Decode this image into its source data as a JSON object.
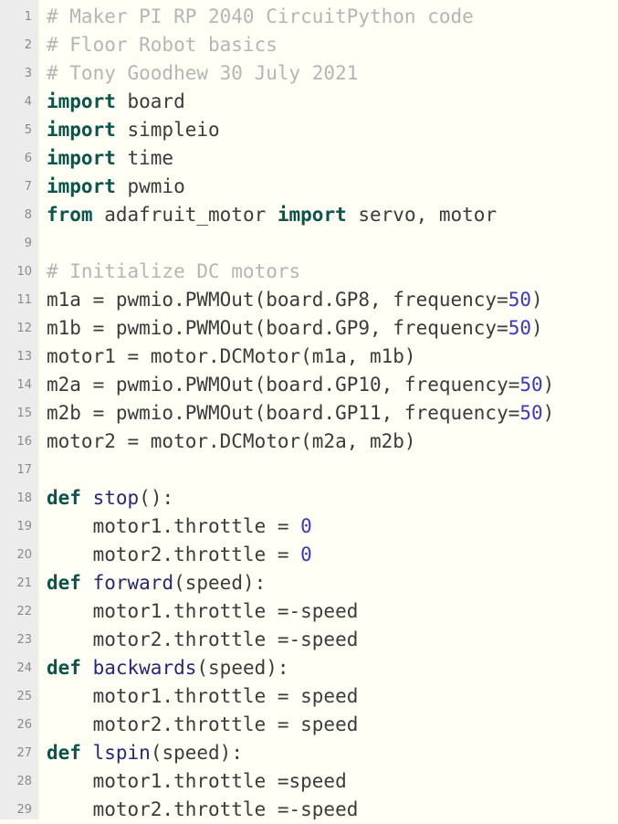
{
  "editor": {
    "language": "python",
    "total_lines": 29,
    "colors": {
      "gutter_background": "#ececec",
      "gutter_text": "#8a8a8a",
      "code_background": "#fffff5",
      "plain_text": "#3b3b3b",
      "comment": "#b5b5b5",
      "keyword": "#0a5449",
      "function_name": "#27277a",
      "number": "#3838c4"
    }
  },
  "lines": [
    {
      "number": "1",
      "tokens": [
        {
          "t": "# Maker PI RP 2040 CircuitPython code",
          "c": "comment"
        }
      ]
    },
    {
      "number": "2",
      "tokens": [
        {
          "t": "# Floor Robot basics",
          "c": "comment"
        }
      ]
    },
    {
      "number": "3",
      "tokens": [
        {
          "t": "# Tony Goodhew 30 July 2021",
          "c": "comment"
        }
      ]
    },
    {
      "number": "4",
      "tokens": [
        {
          "t": "import",
          "c": "keyword"
        },
        {
          "t": " board",
          "c": "plain"
        }
      ]
    },
    {
      "number": "5",
      "tokens": [
        {
          "t": "import",
          "c": "keyword"
        },
        {
          "t": " simpleio",
          "c": "plain"
        }
      ]
    },
    {
      "number": "6",
      "tokens": [
        {
          "t": "import",
          "c": "keyword"
        },
        {
          "t": " time",
          "c": "plain"
        }
      ]
    },
    {
      "number": "7",
      "tokens": [
        {
          "t": "import",
          "c": "keyword"
        },
        {
          "t": " pwmio",
          "c": "plain"
        }
      ]
    },
    {
      "number": "8",
      "tokens": [
        {
          "t": "from",
          "c": "keyword"
        },
        {
          "t": " adafruit_motor ",
          "c": "plain"
        },
        {
          "t": "import",
          "c": "keyword"
        },
        {
          "t": " servo, motor",
          "c": "plain"
        }
      ]
    },
    {
      "number": "9",
      "tokens": []
    },
    {
      "number": "10",
      "tokens": [
        {
          "t": "# Initialize DC motors",
          "c": "comment"
        }
      ]
    },
    {
      "number": "11",
      "tokens": [
        {
          "t": "m1a = pwmio.PWMOut(board.GP8, frequency=",
          "c": "plain"
        },
        {
          "t": "50",
          "c": "number"
        },
        {
          "t": ")",
          "c": "plain"
        }
      ]
    },
    {
      "number": "12",
      "tokens": [
        {
          "t": "m1b = pwmio.PWMOut(board.GP9, frequency=",
          "c": "plain"
        },
        {
          "t": "50",
          "c": "number"
        },
        {
          "t": ")",
          "c": "plain"
        }
      ]
    },
    {
      "number": "13",
      "tokens": [
        {
          "t": "motor1 = motor.DCMotor(m1a, m1b)",
          "c": "plain"
        }
      ]
    },
    {
      "number": "14",
      "tokens": [
        {
          "t": "m2a = pwmio.PWMOut(board.GP10, frequency=",
          "c": "plain"
        },
        {
          "t": "50",
          "c": "number"
        },
        {
          "t": ")",
          "c": "plain"
        }
      ]
    },
    {
      "number": "15",
      "tokens": [
        {
          "t": "m2b = pwmio.PWMOut(board.GP11, frequency=",
          "c": "plain"
        },
        {
          "t": "50",
          "c": "number"
        },
        {
          "t": ")",
          "c": "plain"
        }
      ]
    },
    {
      "number": "16",
      "tokens": [
        {
          "t": "motor2 = motor.DCMotor(m2a, m2b)",
          "c": "plain"
        }
      ]
    },
    {
      "number": "17",
      "tokens": []
    },
    {
      "number": "18",
      "tokens": [
        {
          "t": "def",
          "c": "keyword"
        },
        {
          "t": " ",
          "c": "plain"
        },
        {
          "t": "stop",
          "c": "func"
        },
        {
          "t": "():",
          "c": "plain"
        }
      ]
    },
    {
      "number": "19",
      "tokens": [
        {
          "t": "    motor1.throttle = ",
          "c": "plain"
        },
        {
          "t": "0",
          "c": "number"
        }
      ]
    },
    {
      "number": "20",
      "tokens": [
        {
          "t": "    motor2.throttle = ",
          "c": "plain"
        },
        {
          "t": "0",
          "c": "number"
        }
      ]
    },
    {
      "number": "21",
      "tokens": [
        {
          "t": "def",
          "c": "keyword"
        },
        {
          "t": " ",
          "c": "plain"
        },
        {
          "t": "forward",
          "c": "func"
        },
        {
          "t": "(speed):",
          "c": "plain"
        }
      ]
    },
    {
      "number": "22",
      "tokens": [
        {
          "t": "    motor1.throttle =-speed",
          "c": "plain"
        }
      ]
    },
    {
      "number": "23",
      "tokens": [
        {
          "t": "    motor2.throttle =-speed",
          "c": "plain"
        }
      ]
    },
    {
      "number": "24",
      "tokens": [
        {
          "t": "def",
          "c": "keyword"
        },
        {
          "t": " ",
          "c": "plain"
        },
        {
          "t": "backwards",
          "c": "func"
        },
        {
          "t": "(speed):",
          "c": "plain"
        }
      ]
    },
    {
      "number": "25",
      "tokens": [
        {
          "t": "    motor1.throttle = speed",
          "c": "plain"
        }
      ]
    },
    {
      "number": "26",
      "tokens": [
        {
          "t": "    motor2.throttle = speed",
          "c": "plain"
        }
      ]
    },
    {
      "number": "27",
      "tokens": [
        {
          "t": "def",
          "c": "keyword"
        },
        {
          "t": " ",
          "c": "plain"
        },
        {
          "t": "lspin",
          "c": "func"
        },
        {
          "t": "(speed):",
          "c": "plain"
        }
      ]
    },
    {
      "number": "28",
      "tokens": [
        {
          "t": "    motor1.throttle =speed",
          "c": "plain"
        }
      ]
    },
    {
      "number": "29",
      "tokens": [
        {
          "t": "    motor2.throttle =-speed",
          "c": "plain"
        }
      ]
    }
  ]
}
